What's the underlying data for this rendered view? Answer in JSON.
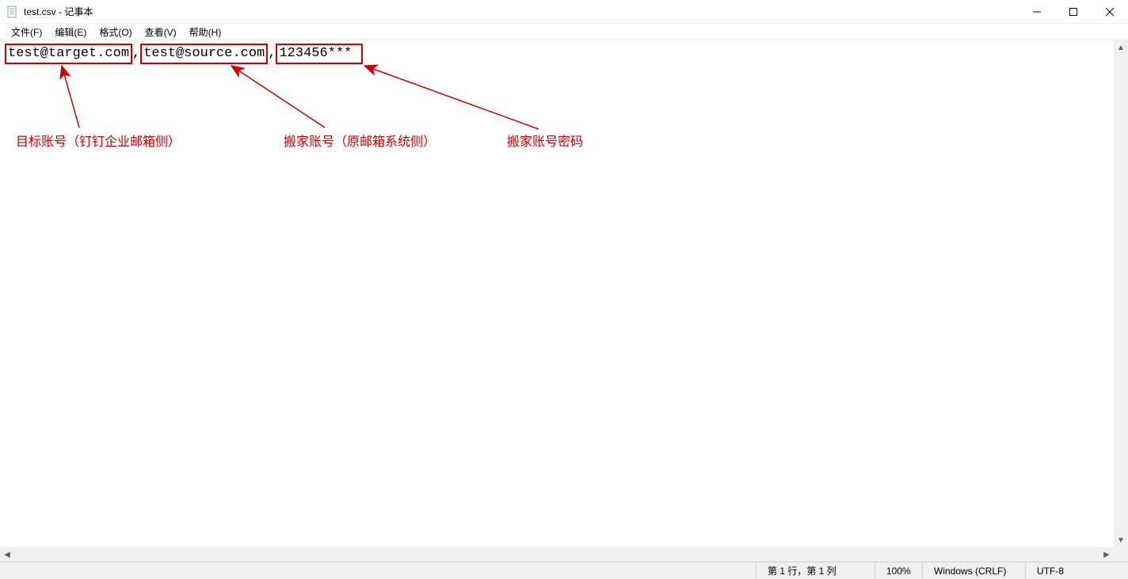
{
  "window": {
    "title": "test.csv - 记事本"
  },
  "menu": {
    "file": "文件(F)",
    "edit": "编辑(E)",
    "format": "格式(O)",
    "view": "查看(V)",
    "help": "帮助(H)"
  },
  "content": {
    "field1": "test@target.com",
    "sep1": ",",
    "field2": "test@source.com",
    "sep2": ",",
    "field3": "123456***"
  },
  "annotations": {
    "label1": "目标账号（钉钉企业邮箱侧）",
    "label2": "搬家账号（原邮箱系统侧）",
    "label3": "搬家账号密码"
  },
  "status": {
    "position": "第 1 行，第 1 列",
    "zoom": "100%",
    "lineending": "Windows (CRLF)",
    "encoding": "UTF-8"
  }
}
